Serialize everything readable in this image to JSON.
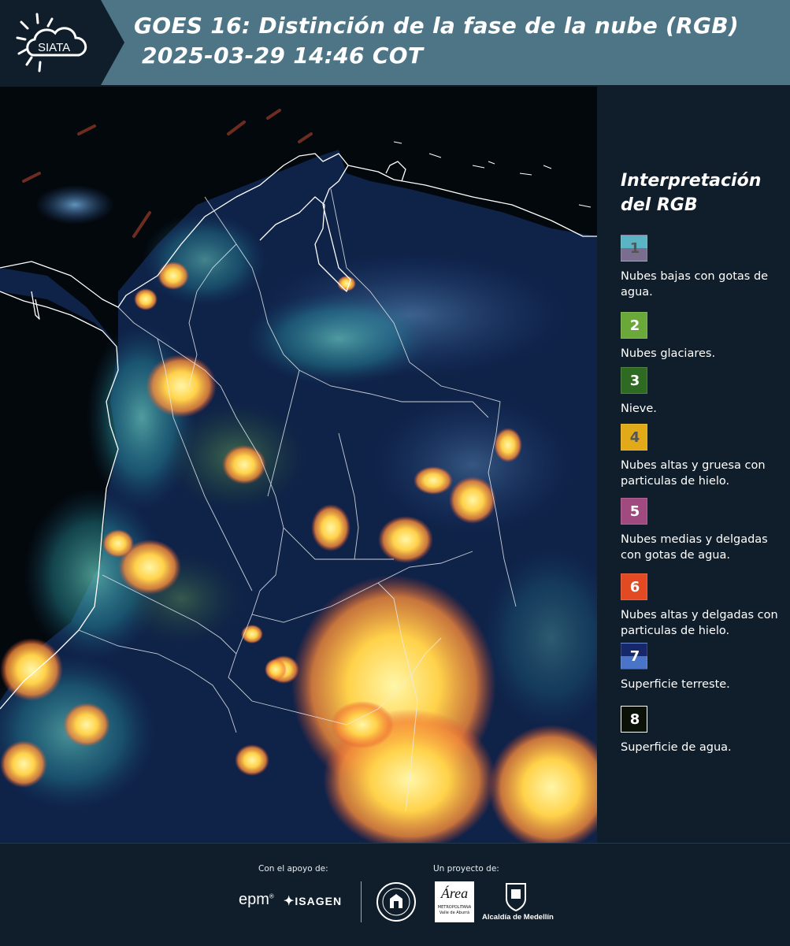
{
  "header": {
    "logo_text": "SIATA",
    "title_line1": "GOES 16: Distinción de la fase de la nube (RGB)",
    "title_line2": " 2025-03-29 14:46 COT"
  },
  "legend": {
    "title_line1": "Interpretación",
    "title_line2": "del RGB",
    "items": [
      {
        "num": "1",
        "label": "Nubes bajas con gotas de agua.",
        "color_top": "#5ab4c4",
        "color_bottom": "#7a6e8e",
        "num_color": "#555555"
      },
      {
        "num": "2",
        "label": "Nubes glaciares.",
        "color_top": "#6aa83a",
        "color_bottom": "#6aa83a",
        "num_color": "#ffffff"
      },
      {
        "num": "3",
        "label": "Nieve.",
        "color_top": "#2e6a22",
        "color_bottom": "#2e6a22",
        "num_color": "#ffffff"
      },
      {
        "num": "4",
        "label": "Nubes altas y gruesa con particulas de hielo.",
        "color_top": "#e2aa18",
        "color_bottom": "#e2aa18",
        "num_color": "#555555"
      },
      {
        "num": "5",
        "label": "Nubes medias y delgadas con gotas de agua.",
        "color_top": "#a04a80",
        "color_bottom": "#a04a80",
        "num_color": "#ffffff"
      },
      {
        "num": "6",
        "label": "Nubes altas y delgadas con particulas de hielo.",
        "color_top": "#e24a24",
        "color_bottom": "#e24a24",
        "num_color": "#ffffff"
      },
      {
        "num": "7",
        "label": "Superficie terreste.",
        "color_top": "#16286a",
        "color_bottom": "#4a74c8",
        "num_color": "#ffffff"
      },
      {
        "num": "8",
        "label": "Superficie de agua.",
        "color_top": "#0a1208",
        "color_bottom": "#0a1208",
        "num_color": "#ffffff"
      }
    ]
  },
  "footer": {
    "support_label": "Con el apoyo de:",
    "project_label": "Un proyecto de:",
    "epm_text": "epm",
    "isagen_text": "ISAGEN",
    "area_text": "Área",
    "area_subtext": "METROPOLITANA",
    "area_subtext2": "Valle de Aburrá",
    "alcaldia_text": "Alcaldía de Medellín"
  }
}
